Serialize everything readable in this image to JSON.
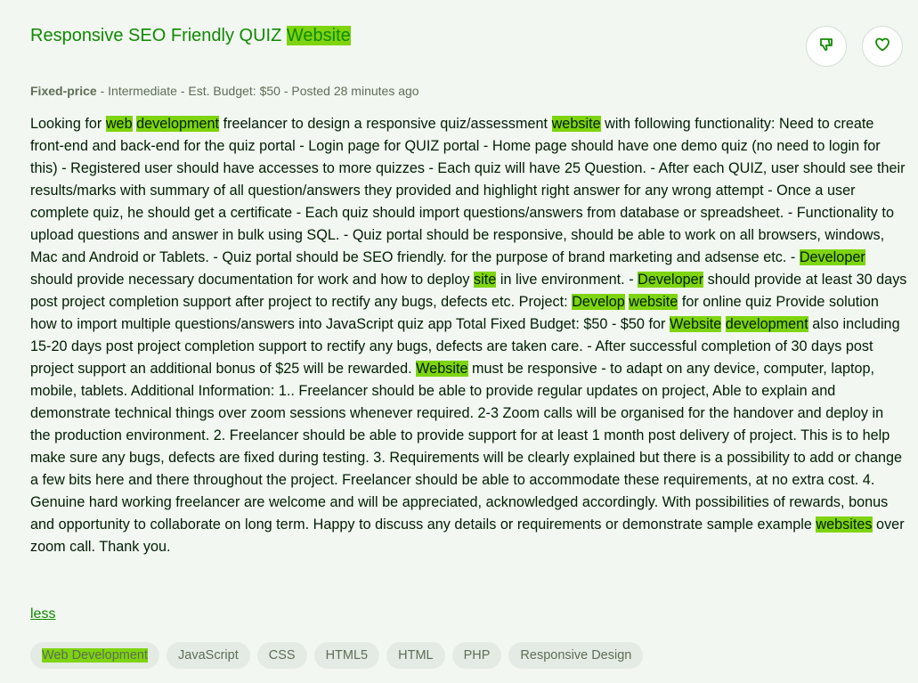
{
  "job": {
    "title_pre": "Responsive SEO Friendly QUIZ ",
    "title_hl": "Website",
    "price_type": "Fixed-price",
    "meta_rest": " - Intermediate - Est. Budget: $50 - Posted 28 minutes ago",
    "description": [
      {
        "t": "Looking for "
      },
      {
        "t": "web",
        "hl": true
      },
      {
        "t": " "
      },
      {
        "t": "development",
        "hl": true
      },
      {
        "t": " freelancer to design a responsive quiz/assessment "
      },
      {
        "t": "website",
        "hl": true
      },
      {
        "t": " with following functionality: Need to create front-end and back-end for the quiz portal - Login page for QUIZ portal - Home page should have one demo quiz (no need to login for this) - Registered user should have accesses to more quizzes - Each quiz will have 25 Question. - After each QUIZ, user should see their results/marks with summary of all question/answers they provided and highlight right answer for any wrong attempt - Once a user complete quiz, he should get a certificate - Each quiz should import questions/answers from database or spreadsheet. - Functionality to upload questions and answer in bulk using SQL. - Quiz portal should be responsive, should be able to work on all browsers, windows, Mac and Android or Tablets. - Quiz portal should be SEO friendly. for the purpose of brand marketing and adsense etc. - "
      },
      {
        "t": "Developer",
        "hl": true
      },
      {
        "t": " should provide necessary documentation for work and how to deploy "
      },
      {
        "t": "site",
        "hl": true
      },
      {
        "t": " in live environment. - "
      },
      {
        "t": "Developer",
        "hl": true
      },
      {
        "t": " should provide at least 30 days post project completion support after project to rectify any bugs, defects etc. Project: "
      },
      {
        "t": "Develop",
        "hl": true
      },
      {
        "t": " "
      },
      {
        "t": "website",
        "hl": true
      },
      {
        "t": " for online quiz Provide solution how to import multiple questions/answers into JavaScript quiz app Total Fixed Budget: $50 - $50 for "
      },
      {
        "t": "Website",
        "hl": true
      },
      {
        "t": " "
      },
      {
        "t": "development",
        "hl": true
      },
      {
        "t": " also including 15-20 days post project completion support to rectify any bugs, defects are taken care. - After successful completion of 30 days post project support an additional bonus of $25 will be rewarded. "
      },
      {
        "t": "Website",
        "hl": true
      },
      {
        "t": " must be responsive - to adapt on any device, computer, laptop, mobile, tablets. Additional Information: 1.. Freelancer should be able to provide regular updates on project, Able to explain and demonstrate technical things over zoom sessions whenever required. 2-3 Zoom calls will be organised for the handover and deploy in the production environment. 2. Freelancer should be able to provide support for at least 1 month post delivery of project. This is to help make sure any bugs, defects are fixed during testing. 3. Requirements will be clearly explained but there is a possibility to add or change a few bits here and there throughout the project. Freelancer should be able to accommodate these requirements, at no extra cost. 4. Genuine hard working freelancer are welcome and will be appreciated, acknowledged accordingly. With possibilities of rewards, bonus and opportunity to collaborate on long term. Happy to discuss any details or requirements or demonstrate sample example "
      },
      {
        "t": "websites",
        "hl": true
      },
      {
        "t": " over zoom call. Thank you."
      }
    ],
    "less_label": "less",
    "tags": [
      {
        "label": "Web Development",
        "hl": true
      },
      {
        "label": "JavaScript"
      },
      {
        "label": "CSS"
      },
      {
        "label": "HTML5"
      },
      {
        "label": "HTML"
      },
      {
        "label": "PHP"
      },
      {
        "label": "Responsive Design"
      }
    ]
  },
  "actions": {
    "dislike_icon": "thumbs-down-icon",
    "save_icon": "heart-icon"
  },
  "colors": {
    "highlight": "#7ed40f",
    "title_green": "#108a00",
    "background": "#f2f7f2",
    "tag_bg": "#e4ebe4"
  }
}
